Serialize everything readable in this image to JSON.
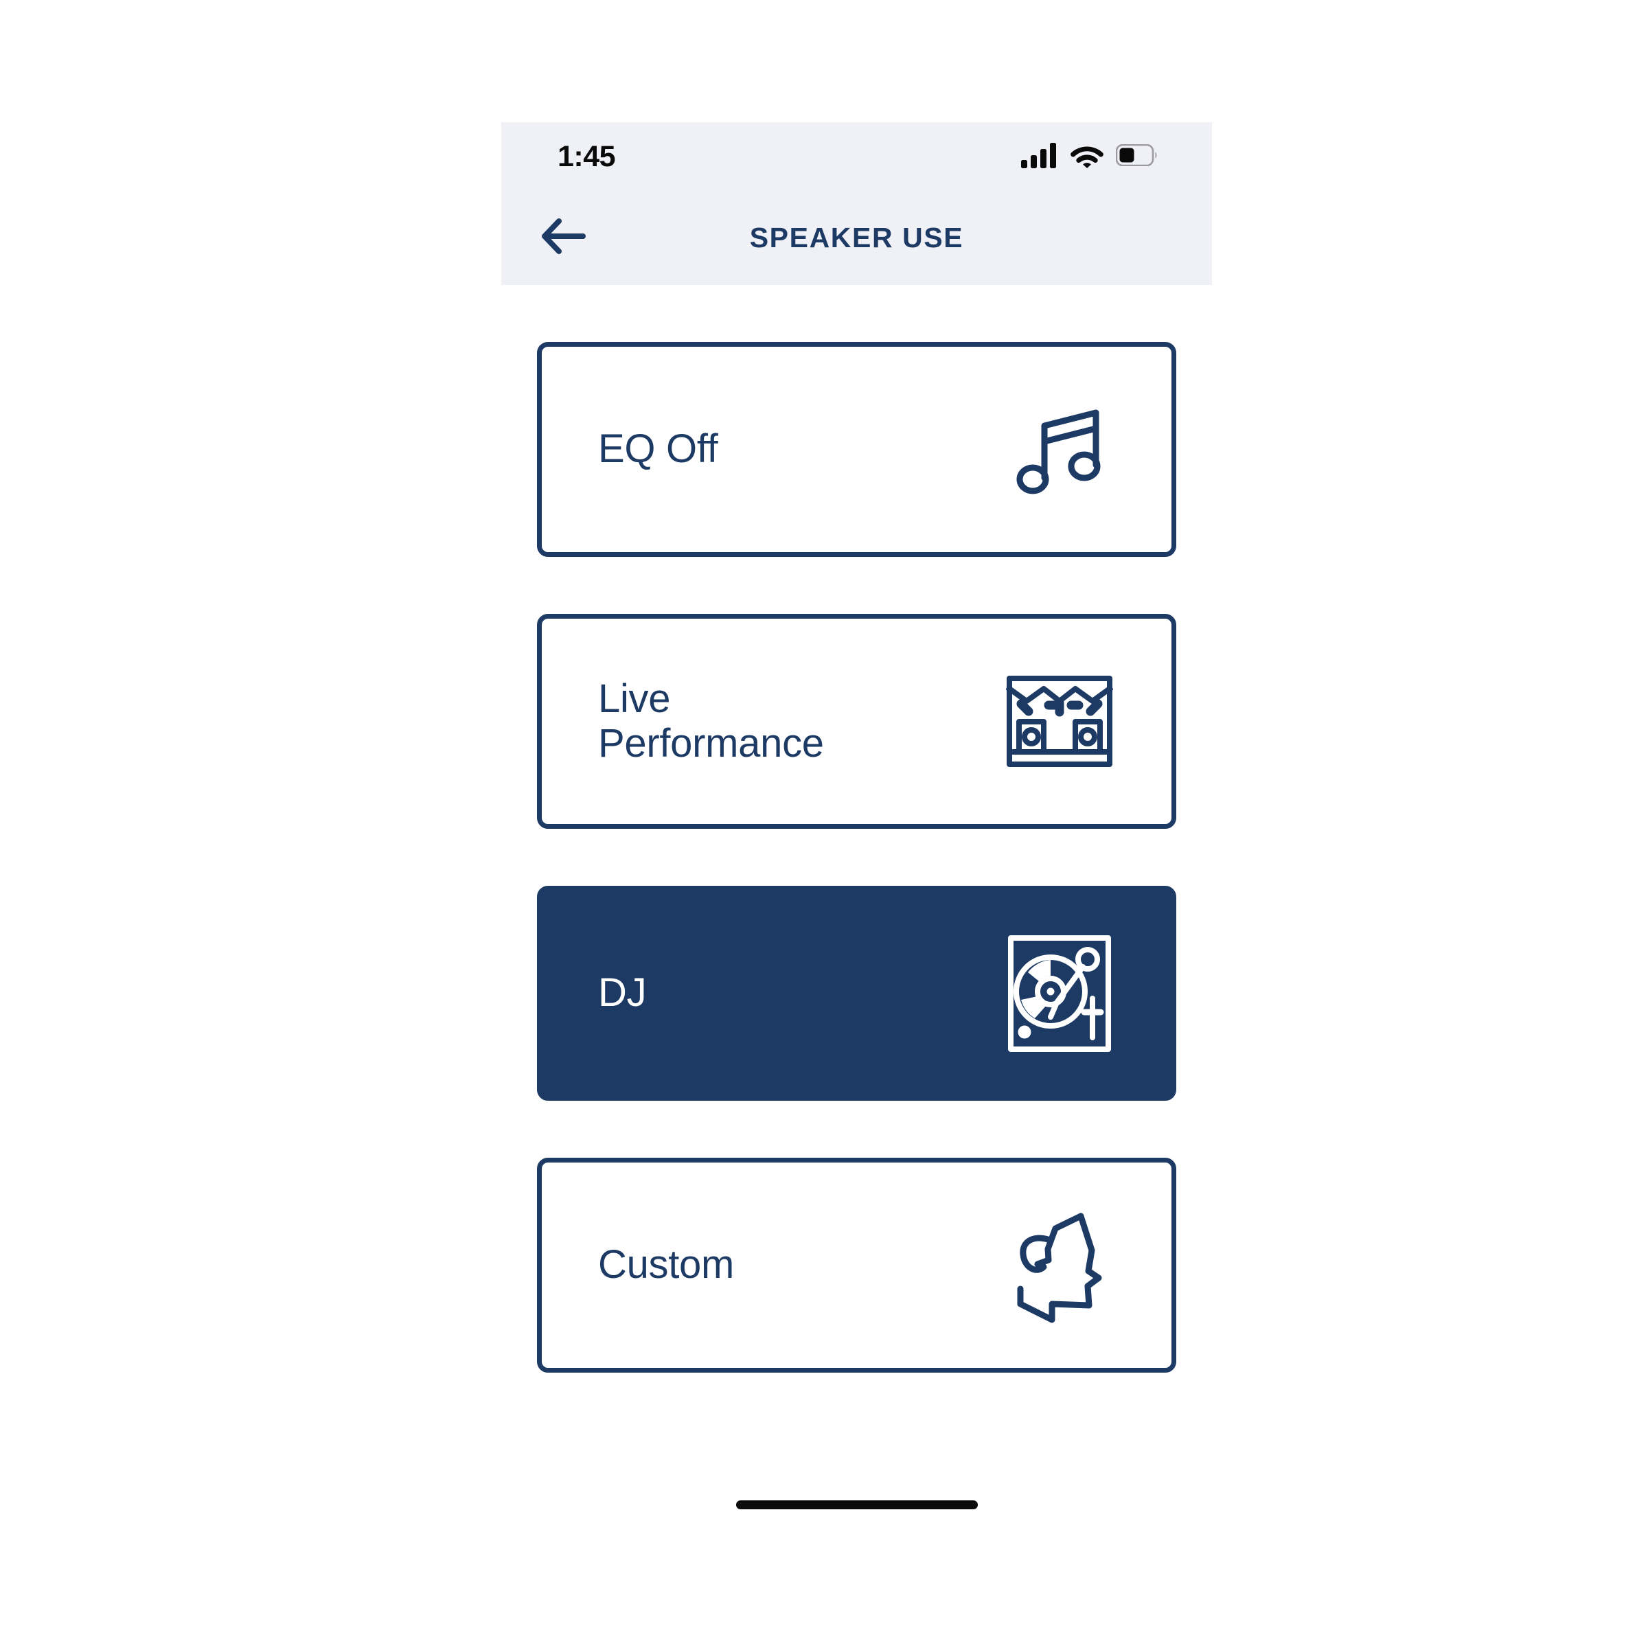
{
  "status_bar": {
    "time": "1:45",
    "signal_icon": "cellular-signal-icon",
    "wifi_icon": "wifi-icon",
    "battery_icon": "battery-icon",
    "battery_level_percent": 40,
    "signal_bars": 4
  },
  "header": {
    "title": "SPEAKER USE",
    "back_icon": "arrow-left-icon"
  },
  "colors": {
    "navy": "#1d3a64",
    "chrome_bg": "#f0f1f6",
    "page_bg": "#ffffff",
    "selected_text": "#ffffff"
  },
  "options": [
    {
      "id": "eq-off",
      "label": "EQ Off",
      "icon": "music-note-icon",
      "selected": false
    },
    {
      "id": "live-performance",
      "label": "Live\nPerformance",
      "icon": "stage-icon",
      "selected": false
    },
    {
      "id": "dj",
      "label": "DJ",
      "icon": "turntable-icon",
      "selected": true
    },
    {
      "id": "custom",
      "label": "Custom",
      "icon": "head-profile-icon",
      "selected": false
    }
  ],
  "home_indicator": {
    "label": "home-indicator"
  }
}
